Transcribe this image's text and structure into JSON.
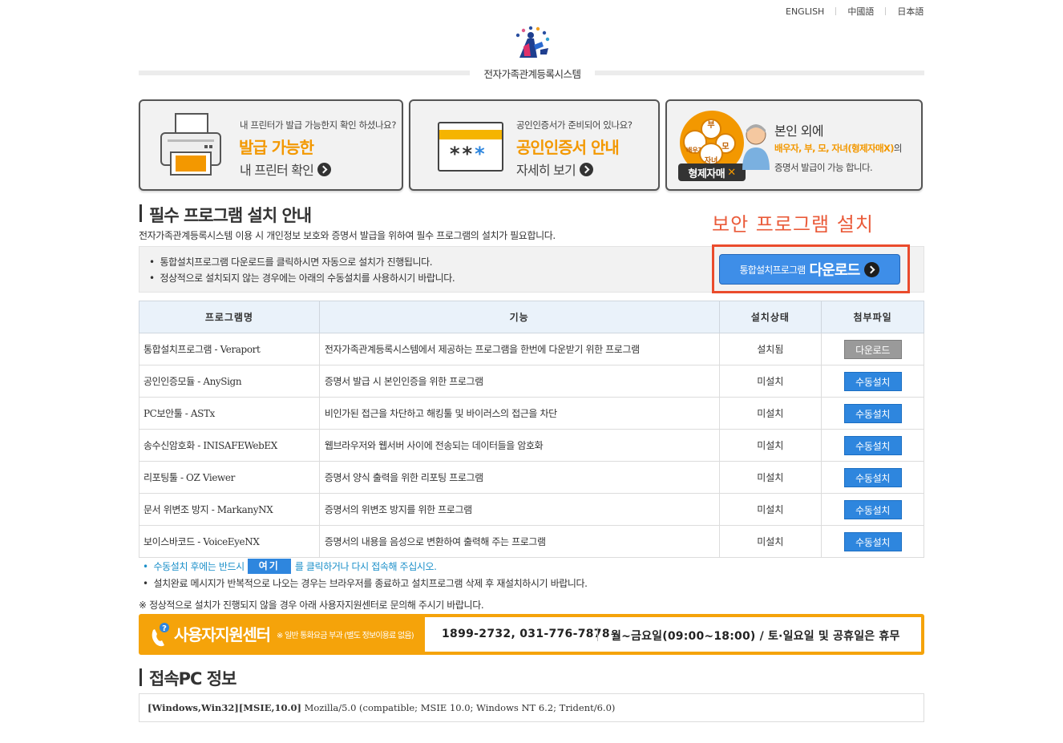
{
  "lang_links": [
    "ENGLISH",
    "中國語",
    "日本語"
  ],
  "site_title": "전자가족관계등록시스템",
  "boxes": [
    {
      "small": "내 프린터가 발급 가능한지 확인 하셨나요?",
      "big": "발급 가능한",
      "sub": "내 프린터 확인"
    },
    {
      "small": "공인인증서가 준비되어 있나요?",
      "big": "공인인증서 안내",
      "sub": "자세히 보기",
      "card_stars": "**",
      "card_star_blue": "*"
    },
    {
      "badge": "형제자매",
      "bubble_labels": [
        "부",
        "모",
        "배우자",
        "자녀"
      ],
      "line1": "본인 외에",
      "line2_highlight": "배우자, 부, 모, 자녀(형제자매X)",
      "line2_suffix": "의",
      "line3": "증명서 발급이 가능 합니다."
    }
  ],
  "section1": {
    "title": "필수 프로그램 설치 안내",
    "description": "전자가족관계등록시스템 이용 시 개인정보 보호와 증명서 발급을 위하여 필수 프로그램의 설치가 필요합니다.",
    "security_label": "보안 프로그램 설치",
    "notices": [
      "통합설치프로그램 다운로드를 클릭하시면 자동으로 설치가 진행됩니다.",
      "정상적으로 설치되지 않는 경우에는 아래의 수동설치를 사용하시기 바랍니다."
    ],
    "download_button": {
      "small": "통합설치프로그램",
      "large": "다운로드"
    }
  },
  "table": {
    "headers": [
      "프로그램명",
      "기능",
      "설치상태",
      "첨부파일"
    ],
    "rows": [
      {
        "name": "통합설치프로그램 - Veraport",
        "function": "전자가족관계등록시스템에서 제공하는 프로그램을 한번에 다운받기 위한 프로그램",
        "status": "설치됨",
        "action": "다운로드",
        "installed": true
      },
      {
        "name": "공인인증모듈 - AnySign",
        "function": "증명서 발급 시 본인인증을 위한 프로그램",
        "status": "미설치",
        "action": "수동설치",
        "installed": false
      },
      {
        "name": "PC보안툴 - ASTx",
        "function": "비인가된 접근을 차단하고 해킹툴 및 바이러스의 접근을 차단",
        "status": "미설치",
        "action": "수동설치",
        "installed": false
      },
      {
        "name": "송수신암호화 - INISAFEWebEX",
        "function": "웹브라우저와 웹서버 사이에 전송되는 데이터들을 암호화",
        "status": "미설치",
        "action": "수동설치",
        "installed": false
      },
      {
        "name": "리포팅툴 - OZ Viewer",
        "function": "증명서 양식 출력을 위한 리포팅 프로그램",
        "status": "미설치",
        "action": "수동설치",
        "installed": false
      },
      {
        "name": "문서 위변조 방지 - MarkanyNX",
        "function": "증명서의 위변조 방지를 위한 프로그램",
        "status": "미설치",
        "action": "수동설치",
        "installed": false
      },
      {
        "name": "보이스바코드 - VoiceEyeNX",
        "function": "증명서의 내용을 음성으로 변환하여 출력해 주는 프로그램",
        "status": "미설치",
        "action": "수동설치",
        "installed": false
      }
    ]
  },
  "notes": {
    "bullet": "•",
    "line1_prefix": "수동설치 후에는 반드시",
    "here_button": "여기",
    "line1_suffix": "를 클릭하거나 다시 접속해 주십시오.",
    "line2": "설치완료 메시지가 반복적으로 나오는 경우는 브라우저를 종료하고 설치프로그램 삭제 후 재설치하시기 바랍니다.",
    "line3": "※ 정상적으로 설치가 진행되지 않을 경우 아래 사용자지원센터로 문의해 주시기 바랍니다."
  },
  "support": {
    "title": "사용자지원센터",
    "small": "※ 일반 통화요금 부과 (별도 정보이용료 없음)",
    "phone": "1899-2732, 031-776-7878",
    "hours": "월~금요일(09:00~18:00) / 토·일요일 및 공휴일은 휴무"
  },
  "section2": {
    "title": "접속PC 정보",
    "info_bold": "[Windows,Win32][MSIE,10.0]",
    "info_rest": " Mozilla/5.0 (compatible; MSIE 10.0; Windows NT 6.2; Trident/6.0)"
  },
  "colors": {
    "accent_orange": "#f39800",
    "accent_blue": "#2e86de",
    "highlight_red": "#ea4b2c",
    "support_bar": "#f5a30a"
  }
}
